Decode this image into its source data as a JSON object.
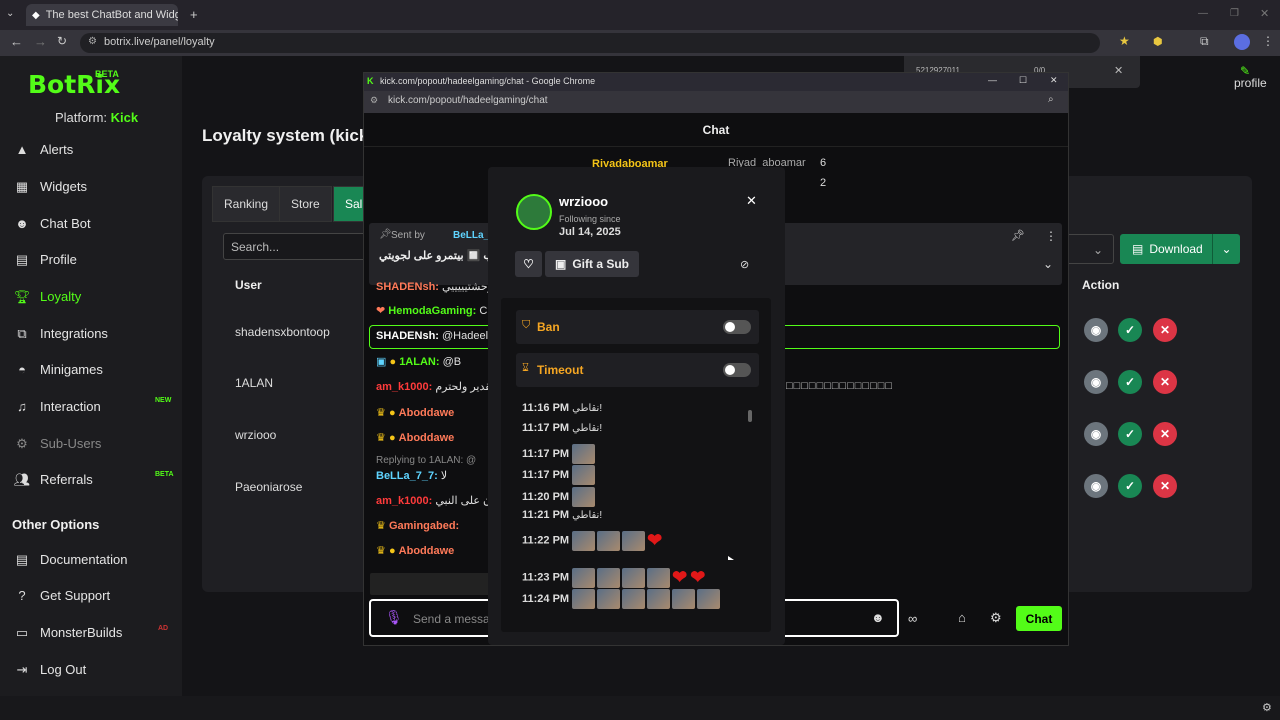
{
  "browser": {
    "tab_title": "The best ChatBot and Widgets",
    "url": "botrix.live/panel/loyalty"
  },
  "sidebar": {
    "logo": "BotRix",
    "beta": "BETA",
    "platform_label": "Platform:",
    "platform_value": "Kick",
    "items": [
      {
        "label": "Alerts",
        "icon": "triangle-alert-icon"
      },
      {
        "label": "Widgets",
        "icon": "grid-icon"
      },
      {
        "label": "Chat Bot",
        "icon": "robot-icon"
      },
      {
        "label": "Profile",
        "icon": "id-card-icon"
      },
      {
        "label": "Loyalty",
        "icon": "trophy-icon"
      },
      {
        "label": "Integrations",
        "icon": "integrations-icon"
      },
      {
        "label": "Minigames",
        "icon": "gamepad-icon"
      },
      {
        "label": "Interaction",
        "icon": "music-icon"
      },
      {
        "label": "Sub-Users",
        "icon": "users-icon"
      },
      {
        "label": "Referrals",
        "icon": "users-icon"
      }
    ],
    "new_badge": "NEW",
    "beta_badge": "BETA",
    "other_heading": "Other Options",
    "other_items": [
      {
        "label": "Documentation",
        "icon": "book-icon"
      },
      {
        "label": "Get Support",
        "icon": "question-icon"
      },
      {
        "label": "MonsterBuilds",
        "icon": "monitor-icon"
      },
      {
        "label": "Log Out",
        "icon": "logout-icon"
      }
    ],
    "ad_badge": "AD"
  },
  "header": {
    "profile": "profile"
  },
  "loyalty": {
    "title": "Loyalty system (kick",
    "tabs": [
      "Ranking",
      "Store",
      "Sal"
    ],
    "search_placeholder": "Search...",
    "col_user": "User",
    "col_action": "Action",
    "download": "Download",
    "users": [
      "shadensxbontoop",
      "1ALAN",
      "wrziooo",
      "Paeoniarose"
    ]
  },
  "popup": {
    "window_title": "kick.com/popout/hadeelgaming/chat - Google Chrome",
    "url": "kick.com/popout/hadeelgaming/chat",
    "chat_header": "Chat",
    "top_user": "Riyadaboamar",
    "top_user2": "Riyad_aboamar",
    "top_count": "6",
    "top_count2": "2",
    "pinned_sent_by": "Sent by",
    "pinned_user": "BeLLa_7",
    "pinned_text": "لعب 🔲 بيتمرو على لجويتي",
    "messages": [
      {
        "user": "SHADENsh:",
        "color": "#ff7a59",
        "text": "وحشتيييييي"
      },
      {
        "user": "HemodaGaming:",
        "color": "#53fc18",
        "text": "C"
      },
      {
        "user": "SHADENsh:",
        "color": "#ffffff",
        "text": "@Hadeel"
      },
      {
        "user": "1ALAN:",
        "color": "#53fc18",
        "text": "@B"
      },
      {
        "user": "am_k1000:",
        "color": "#ff3b3b",
        "text": "التقدير ولحترم"
      },
      {
        "user": "Aboddawe",
        "color": "#ff7a59",
        "text": ""
      },
      {
        "user": "Aboddawe",
        "color": "#ff7a59",
        "text": ""
      },
      {
        "user": "BeLLa_7_7:",
        "color": "#5fd4ff",
        "text": "لا"
      },
      {
        "user": "am_k1000:",
        "color": "#ff3b3b",
        "text": "لون على النبي"
      },
      {
        "user": "Gamingabed:",
        "color": "#ff7a59",
        "text": ""
      },
      {
        "user": "Aboddawe",
        "color": "#ff7a59",
        "text": ""
      }
    ],
    "reply_text": "Replying to 1ALAN: @",
    "overflow_squares": "□□□□□□□□□□□□□□",
    "input_placeholder": "Send a messa",
    "chat_button": "Chat"
  },
  "usercard": {
    "username": "wrziooo",
    "following_label": "Following since",
    "following_date": "Jul 14, 2025",
    "gift_sub": "Gift a Sub",
    "ban": "Ban",
    "timeout": "Timeout",
    "timeline": [
      {
        "time": "11:16 PM",
        "text": "نقاطي!",
        "emotes": 0,
        "hearts": 0
      },
      {
        "time": "11:17 PM",
        "text": "نقاطي!",
        "emotes": 0,
        "hearts": 0
      },
      {
        "time": "11:17 PM",
        "text": "",
        "emotes": 1,
        "hearts": 0
      },
      {
        "time": "11:17 PM",
        "text": "",
        "emotes": 1,
        "hearts": 0
      },
      {
        "time": "11:20 PM",
        "text": "",
        "emotes": 1,
        "hearts": 0
      },
      {
        "time": "11:21 PM",
        "text": "نقاطي!",
        "emotes": 0,
        "hearts": 0
      },
      {
        "time": "11:22 PM",
        "text": "",
        "emotes": 3,
        "hearts": 1
      },
      {
        "time": "11:23 PM",
        "text": "",
        "emotes": 4,
        "hearts": 2
      },
      {
        "time": "11:24 PM",
        "text": "",
        "emotes": 6,
        "hearts": 0
      }
    ]
  },
  "find_bar": {
    "text": "5212927011",
    "count": "0/0"
  }
}
